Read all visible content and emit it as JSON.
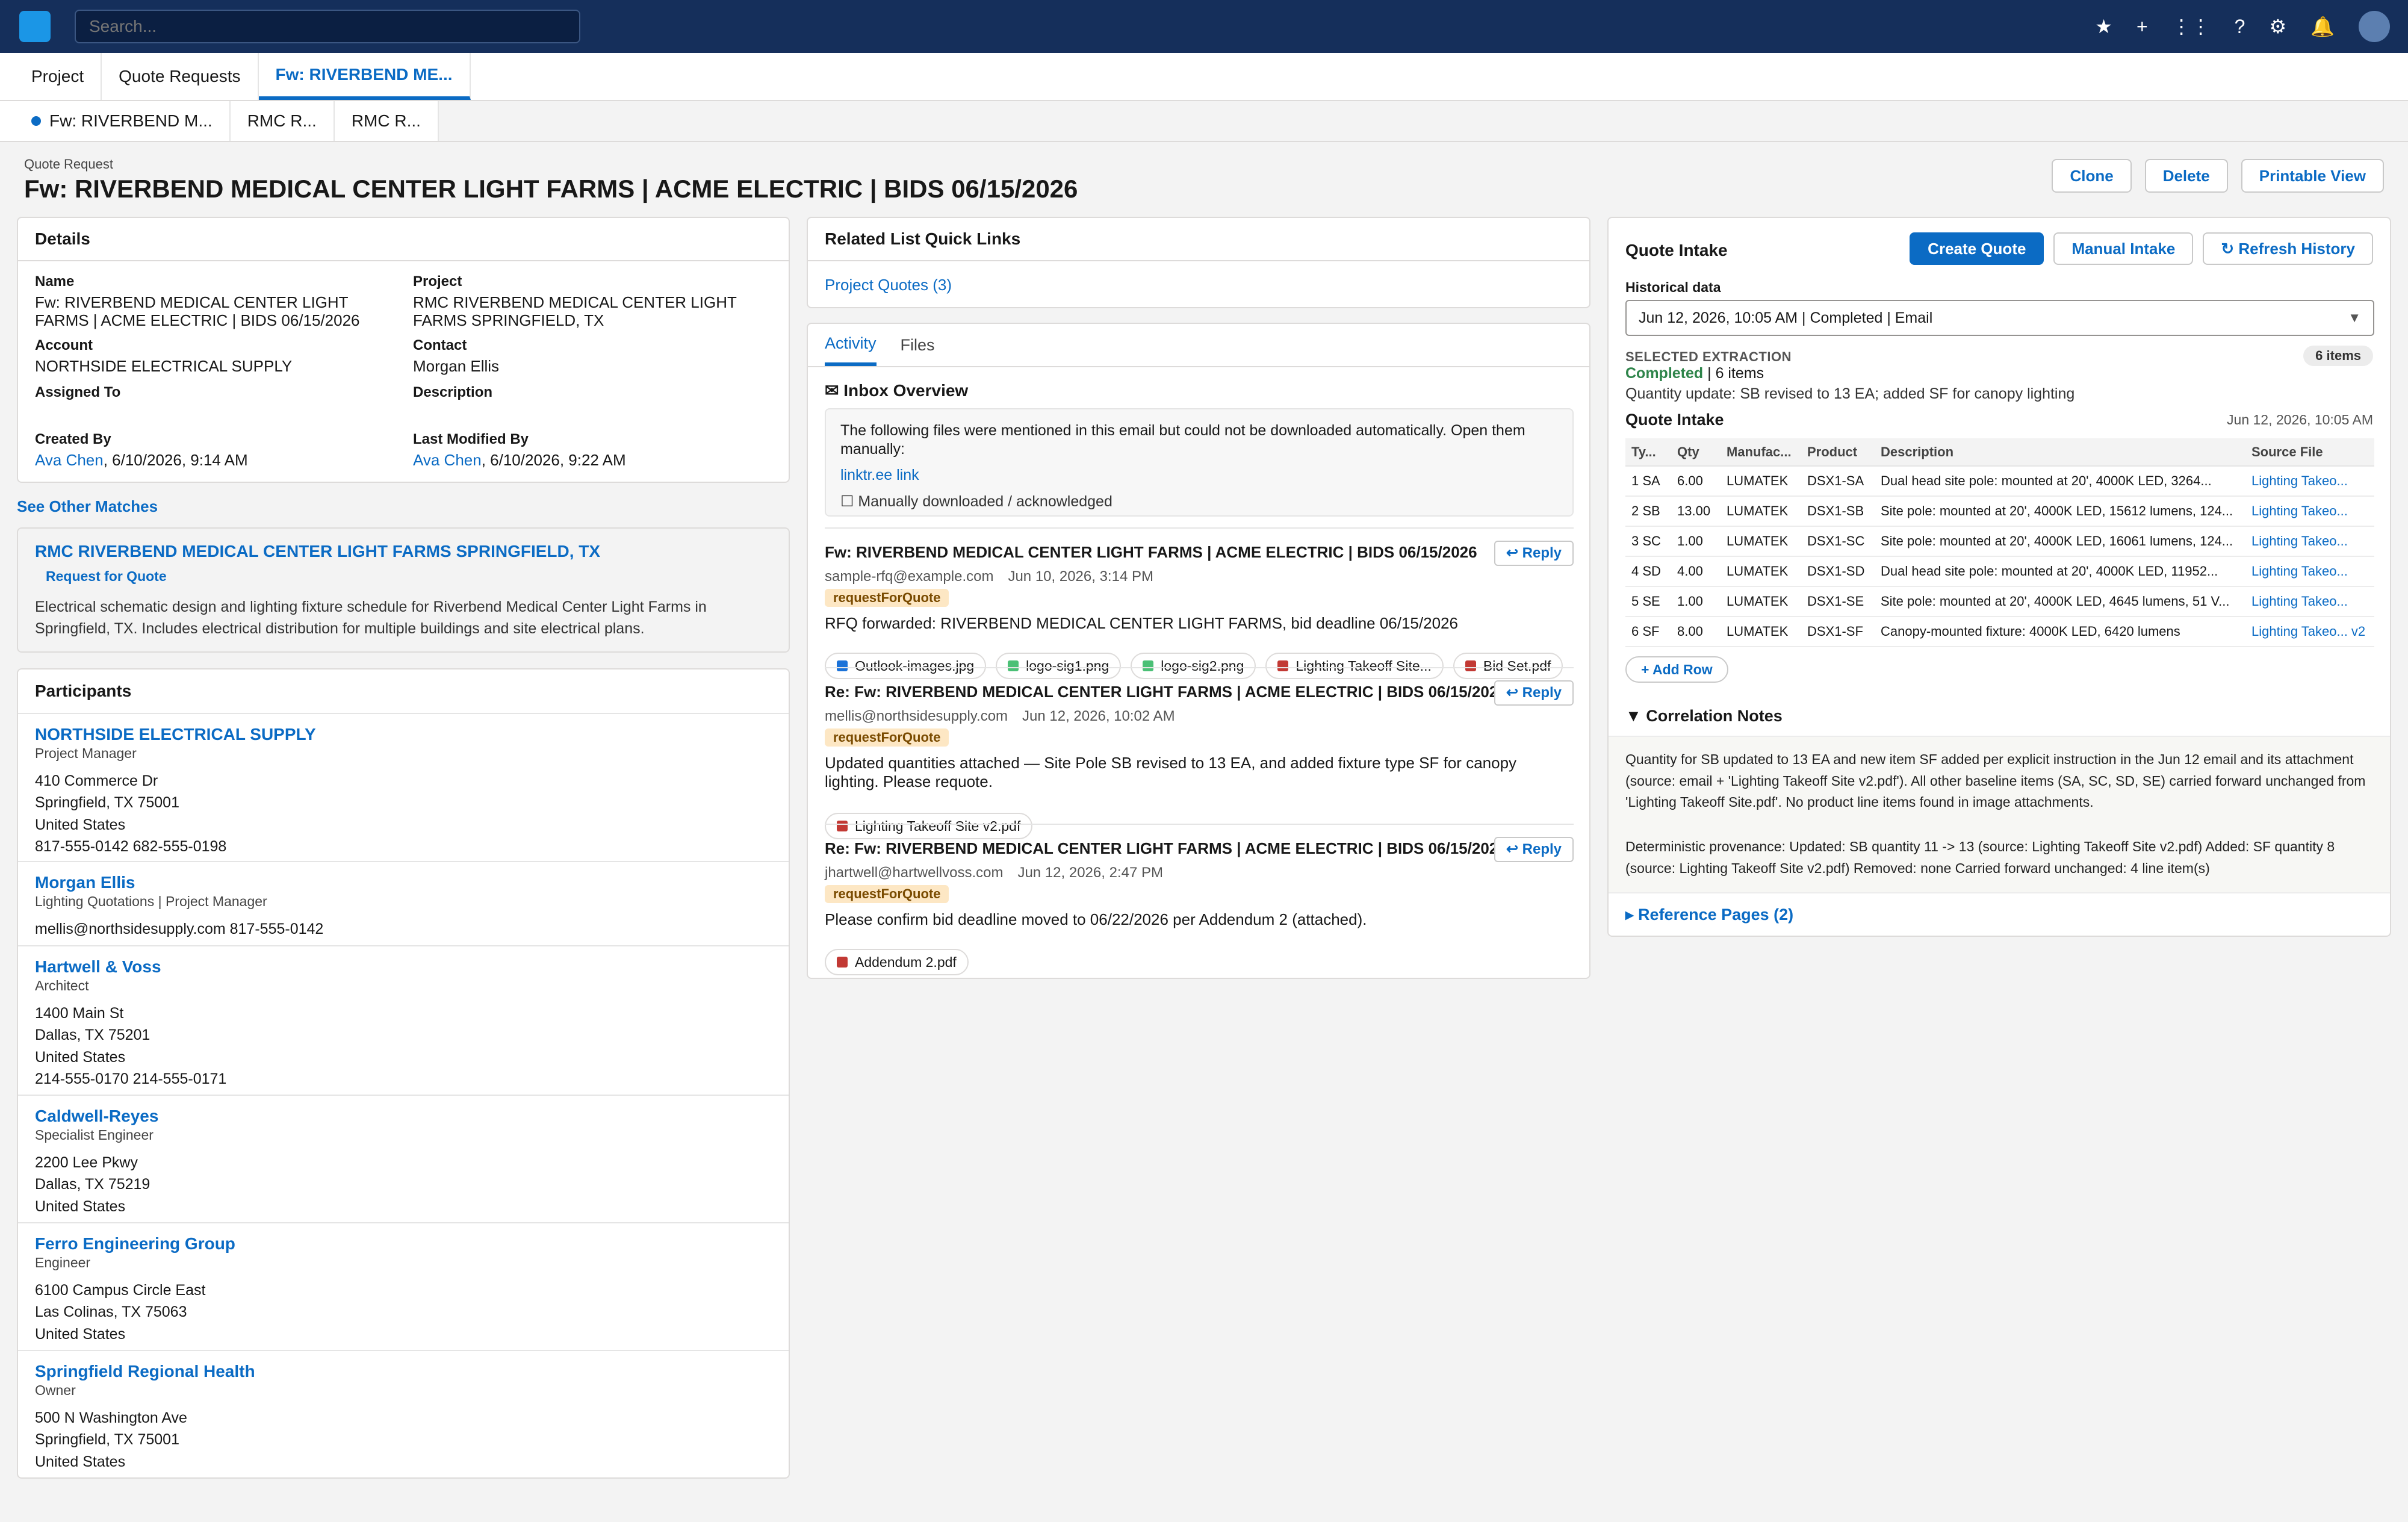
{
  "topnav": {
    "search_placeholder": "Search...",
    "icons": [
      "star-icon",
      "plus-icon",
      "app-launcher-icon",
      "help-icon",
      "gear-icon",
      "bell-icon",
      "avatar"
    ],
    "glyphs": {
      "star": "★",
      "plus": "+",
      "grid": "⋮⋮",
      "help": "?",
      "gear": "⚙",
      "bell": "🔔"
    }
  },
  "tabs": [
    {
      "label": "Project"
    },
    {
      "label": "Quote Requests"
    },
    {
      "label": "Fw: RIVERBEND ME..."
    }
  ],
  "subtabs": [
    {
      "label": "Fw: RIVERBEND M..."
    },
    {
      "label": "RMC R..."
    },
    {
      "label": "RMC R..."
    }
  ],
  "header": {
    "object_label": "Quote Request",
    "title": "Fw: RIVERBEND MEDICAL CENTER LIGHT FARMS | ACME ELECTRIC | BIDS 06/15/2026",
    "buttons": {
      "clone": "Clone",
      "delete": "Delete",
      "printable": "Printable View"
    }
  },
  "details": {
    "heading": "Details",
    "name_label": "Name",
    "name_value": "Fw: RIVERBEND MEDICAL CENTER LIGHT FARMS | ACME ELECTRIC | BIDS 06/15/2026",
    "project_label": "Project",
    "project_value": "RMC RIVERBEND MEDICAL CENTER LIGHT FARMS SPRINGFIELD, TX",
    "account_label": "Account",
    "account_value": "NORTHSIDE ELECTRICAL SUPPLY",
    "contact_label": "Contact",
    "contact_value": "Morgan Ellis",
    "assigned_label": "Assigned To",
    "description_label": "Description",
    "created_label": "Created By",
    "created_user": "Ava Chen",
    "created_date": ", 6/10/2026, 9:14 AM",
    "modified_label": "Last Modified By",
    "modified_user": "Ava Chen",
    "modified_date": ", 6/10/2026, 9:22 AM"
  },
  "matches": {
    "link": "See Other Matches",
    "title": "RMC RIVERBEND MEDICAL CENTER LIGHT FARMS SPRINGFIELD, TX",
    "badge": "Request for Quote",
    "description": "Electrical schematic design and lighting fixture schedule for Riverbend Medical Center Light Farms in Springfield, TX. Includes electrical distribution for multiple buildings and site electrical plans."
  },
  "participants": {
    "heading": "Participants",
    "items": [
      {
        "name": "NORTHSIDE ELECTRICAL SUPPLY",
        "role": "Project Manager",
        "lines": [
          "410 Commerce Dr",
          "Springfield, TX 75001",
          "United States",
          "817-555-0142    682-555-0198"
        ]
      },
      {
        "name": "Morgan Ellis",
        "role": "Lighting Quotations | Project Manager",
        "lines": [
          "mellis@northsidesupply.com    817-555-0142"
        ]
      },
      {
        "name": "Hartwell & Voss",
        "role": "Architect",
        "lines": [
          "1400 Main St",
          "Dallas, TX 75201",
          "United States",
          "214-555-0170    214-555-0171"
        ]
      },
      {
        "name": "Caldwell-Reyes",
        "role": "Specialist Engineer",
        "lines": [
          "2200 Lee Pkwy",
          "Dallas, TX 75219",
          "United States"
        ]
      },
      {
        "name": "Ferro Engineering Group",
        "role": "Engineer",
        "lines": [
          "6100 Campus Circle East",
          "Las Colinas, TX 75063",
          "United States"
        ]
      },
      {
        "name": "Springfield Regional Health",
        "role": "Owner",
        "lines": [
          "500 N Washington Ave",
          "Springfield, TX 75001",
          "United States"
        ]
      }
    ]
  },
  "quick_links": {
    "heading": "Related List Quick Links",
    "link": "Project Quotes (3)"
  },
  "activity": {
    "tabs": [
      "Activity",
      "Files"
    ],
    "inbox_heading": "✉ Inbox Overview",
    "inbox_text": "The following files were mentioned in this email but could not be downloaded automatically. Open them manually:",
    "inbox_link": "linktr.ee link",
    "inbox_check": "☐ Manually downloaded / acknowledged",
    "reply_label": "↩ Reply",
    "emails": [
      {
        "subject": "Fw: RIVERBEND MEDICAL CENTER LIGHT FARMS | ACME ELECTRIC | BIDS 06/15/2026",
        "from": "sample-rfq@example.com",
        "date": "Jun 10, 2026, 3:14 PM",
        "tag": "requestForQuote",
        "body": "RFQ forwarded: RIVERBEND MEDICAL CENTER LIGHT FARMS, bid deadline 06/15/2026",
        "attachments": [
          {
            "name": "Outlook-images.jpg",
            "color": "#1b72d8"
          },
          {
            "name": "logo-sig1.png",
            "color": "#4bc076"
          },
          {
            "name": "logo-sig2.png",
            "color": "#4bc076"
          },
          {
            "name": "Lighting Takeoff Site...",
            "color": "#c23934"
          },
          {
            "name": "Bid Set.pdf",
            "color": "#c23934"
          }
        ]
      },
      {
        "subject": "Re: Fw: RIVERBEND MEDICAL CENTER LIGHT FARMS | ACME ELECTRIC | BIDS 06/15/2026",
        "from": "mellis@northsidesupply.com",
        "date": "Jun 12, 2026, 10:02 AM",
        "tag": "requestForQuote",
        "body": "Updated quantities attached — Site Pole SB revised to 13 EA, and added fixture type SF for canopy lighting. Please requote.",
        "attachments": [
          {
            "name": "Lighting Takeoff Site v2.pdf",
            "color": "#c23934"
          }
        ]
      },
      {
        "subject": "Re: Fw: RIVERBEND MEDICAL CENTER LIGHT FARMS | ACME ELECTRIC | BIDS 06/15/2026",
        "from": "jhartwell@hartwellvoss.com",
        "date": "Jun 12, 2026, 2:47 PM",
        "tag": "requestForQuote",
        "body": "Please confirm bid deadline moved to 06/22/2026 per Addendum 2 (attached).",
        "attachments": [
          {
            "name": "Addendum 2.pdf",
            "color": "#c23934"
          }
        ]
      }
    ]
  },
  "intake": {
    "title": "Quote Intake",
    "buttons": {
      "create": "Create Quote",
      "manual": "Manual Intake",
      "refresh": "↻ Refresh History"
    },
    "historical_label": "Historical data",
    "historical_value": "Jun 12, 2026, 10:05 AM | Completed | Email",
    "selected_label": "SELECTED EXTRACTION",
    "items_pill": "6 items",
    "status_word": "Completed",
    "status_rest": " | 6 items",
    "summary": "Quantity update: SB revised to 13 EA; added SF for canopy lighting",
    "sub_title": "Quote Intake",
    "sub_date": "Jun 12, 2026, 10:05 AM",
    "columns": [
      "Ty...",
      "Qty",
      "Manufac...",
      "Product",
      "Description",
      "Source File"
    ],
    "rows": [
      [
        "1 SA",
        "6.00",
        "LUMATEK",
        "DSX1-SA",
        "Dual head site pole: mounted at 20', 4000K LED, 3264...",
        "Lighting Takeo..."
      ],
      [
        "2 SB",
        "13.00",
        "LUMATEK",
        "DSX1-SB",
        "Site pole: mounted at 20', 4000K LED, 15612 lumens, 124...",
        "Lighting Takeo..."
      ],
      [
        "3 SC",
        "1.00",
        "LUMATEK",
        "DSX1-SC",
        "Site pole: mounted at 20', 4000K LED, 16061 lumens, 124...",
        "Lighting Takeo..."
      ],
      [
        "4 SD",
        "4.00",
        "LUMATEK",
        "DSX1-SD",
        "Dual head site pole: mounted at 20', 4000K LED, 11952...",
        "Lighting Takeo..."
      ],
      [
        "5 SE",
        "1.00",
        "LUMATEK",
        "DSX1-SE",
        "Site pole: mounted at 20', 4000K LED, 4645 lumens, 51 V...",
        "Lighting Takeo..."
      ],
      [
        "6 SF",
        "8.00",
        "LUMATEK",
        "DSX1-SF",
        "Canopy-mounted fixture: 4000K LED, 6420 lumens",
        "Lighting Takeo... v2"
      ]
    ],
    "add_row": "+ Add Row",
    "corr_heading": "▼ Correlation Notes",
    "corr_p1": "Quantity for SB updated to 13 EA and new item SF added per explicit instruction in the Jun 12 email and its attachment (source: email + 'Lighting Takeoff Site v2.pdf'). All other baseline items (SA, SC, SD, SE) carried forward unchanged from 'Lighting Takeoff Site.pdf'. No product line items found in image attachments.",
    "corr_p2": "Deterministic provenance: Updated: SB quantity 11 -> 13 (source: Lighting Takeoff Site v2.pdf) Added: SF quantity 8 (source: Lighting Takeoff Site v2.pdf) Removed: none Carried forward unchanged: 4 line item(s)",
    "ref_pages": "▸ Reference Pages (2)"
  }
}
